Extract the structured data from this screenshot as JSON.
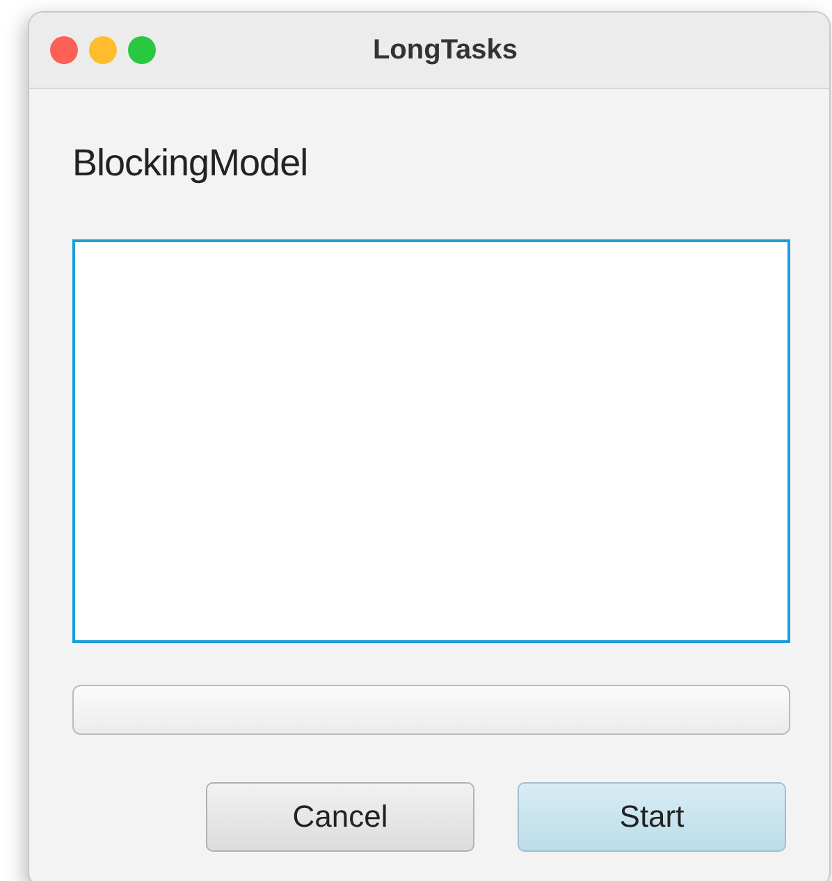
{
  "window": {
    "title": "LongTasks"
  },
  "heading": "BlockingModel",
  "text_area": {
    "focused": true
  },
  "progress": {
    "level": 0
  },
  "buttons": [
    {
      "label": "Cancel",
      "default": false
    },
    {
      "label": "Start",
      "default": true
    }
  ]
}
